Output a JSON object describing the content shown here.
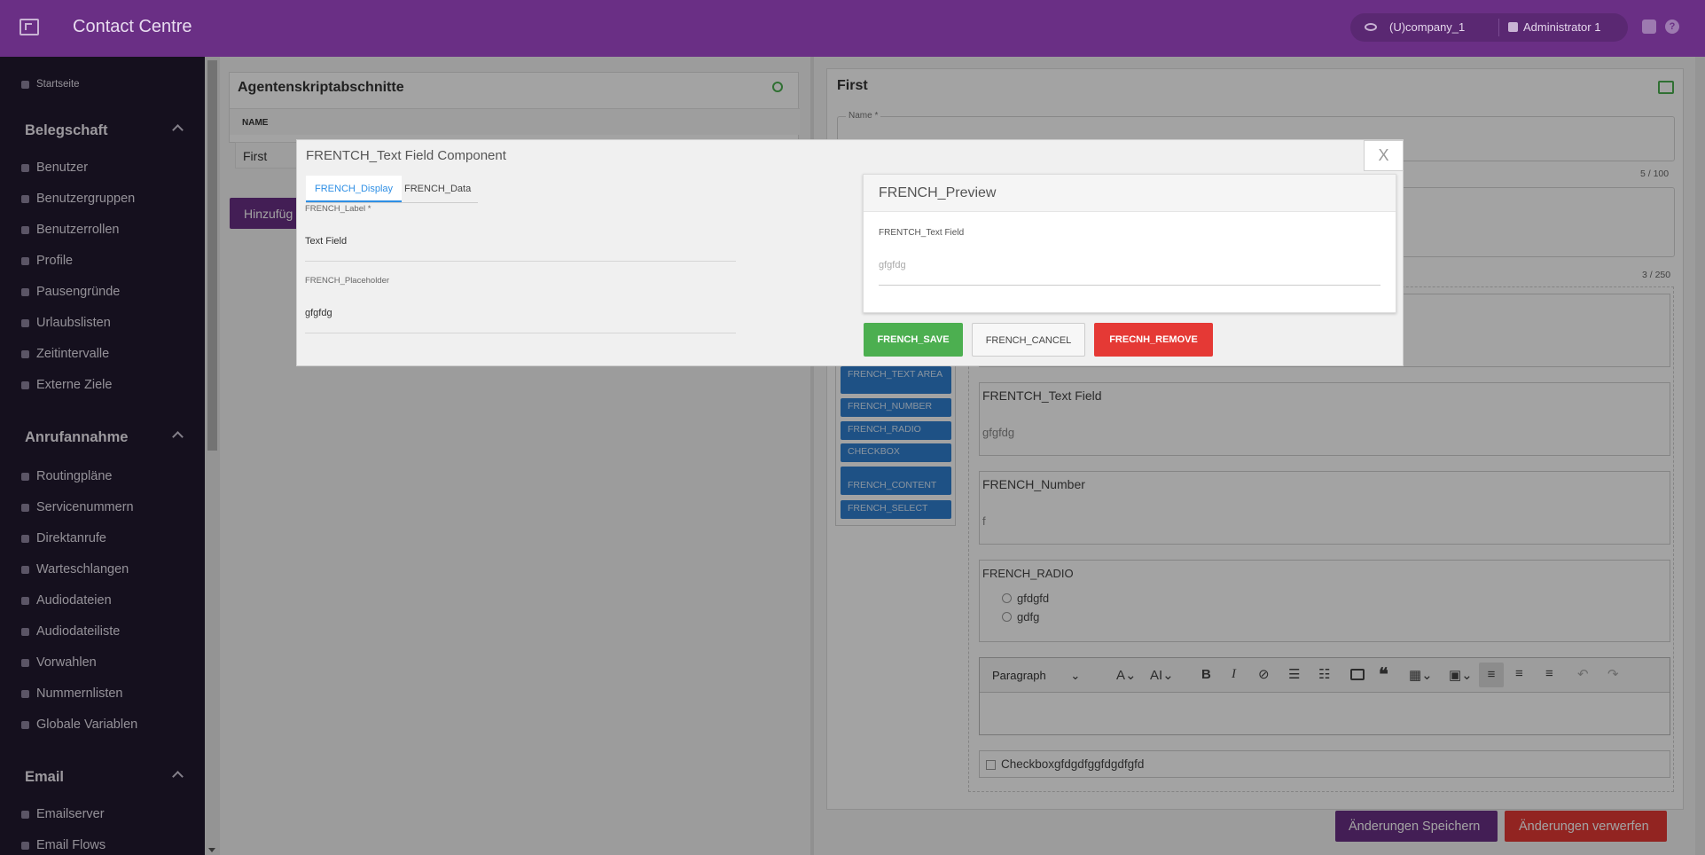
{
  "header": {
    "title": "Contact Centre",
    "company": "(U)company_1",
    "user": "Administrator 1"
  },
  "sidebar": {
    "home": "Startseite",
    "sections": [
      {
        "title": "Belegschaft",
        "items": [
          "Benutzer",
          "Benutzergruppen",
          "Benutzerrollen",
          "Profile",
          "Pausengründe",
          "Urlaubslisten",
          "Zeitintervalle",
          "Externe Ziele"
        ]
      },
      {
        "title": "Anrufannahme",
        "items": [
          "Routingpläne",
          "Servicenummern",
          "Direktanrufe",
          "Warteschlangen",
          "Audiodateien",
          "Audiodateiliste",
          "Vorwahlen",
          "Nummernlisten",
          "Globale Variablen"
        ]
      },
      {
        "title": "Email",
        "items": [
          "Emailserver",
          "Email Flows"
        ]
      }
    ]
  },
  "left_panel": {
    "title": "Agentenskriptabschnitte",
    "col_name": "NAME",
    "row": "First",
    "add_button": "Hinzufüg"
  },
  "right_panel": {
    "title": "First",
    "name_label": "Name *",
    "name_counter": "5 / 100",
    "desc_counter": "3 / 250",
    "tools": [
      "FRENCH_TEXT AREA",
      "FRENCH_NUMBER",
      "FRENCH_RADIO",
      "CHECKBOX",
      "FRENCH_CONTENT",
      "FRENCH_SELECT"
    ],
    "components": {
      "text_field": {
        "label": "FRENTCH_Text Field",
        "value": "gfgfdg"
      },
      "number": {
        "label": "FRENCH_Number",
        "value": "f"
      },
      "radio": {
        "label": "FRENCH_RADIO",
        "options": [
          "gfdgfd",
          "gdfg"
        ]
      },
      "editor": {
        "paragraph": "Paragraph"
      },
      "checkbox": {
        "label": "Checkboxgfdgdfggfdgdfgfd"
      }
    },
    "save_button": "Änderungen Speichern",
    "discard_button": "Änderungen verwerfen"
  },
  "modal": {
    "title": "FRENTCH_Text Field Component",
    "close": "X",
    "tabs": [
      "FRENCH_Display",
      "FRENCH_Data"
    ],
    "label_title": "FRENCH_Label *",
    "label_value": "Text Field",
    "placeholder_title": "FRENCH_Placeholder",
    "placeholder_value": "gfgfdg",
    "preview_title": "FRENCH_Preview",
    "preview_field_label": "FRENTCH_Text Field",
    "preview_placeholder": "gfgfdg",
    "save": "FRENCH_SAVE",
    "cancel": "FRENCH_CANCEL",
    "remove": "FRECNH_REMOVE"
  },
  "colors": {
    "brand": "#6a2f85",
    "sidebar": "#221a30",
    "save": "#4caf50",
    "remove": "#e53935",
    "tool": "#2f7fd0"
  }
}
